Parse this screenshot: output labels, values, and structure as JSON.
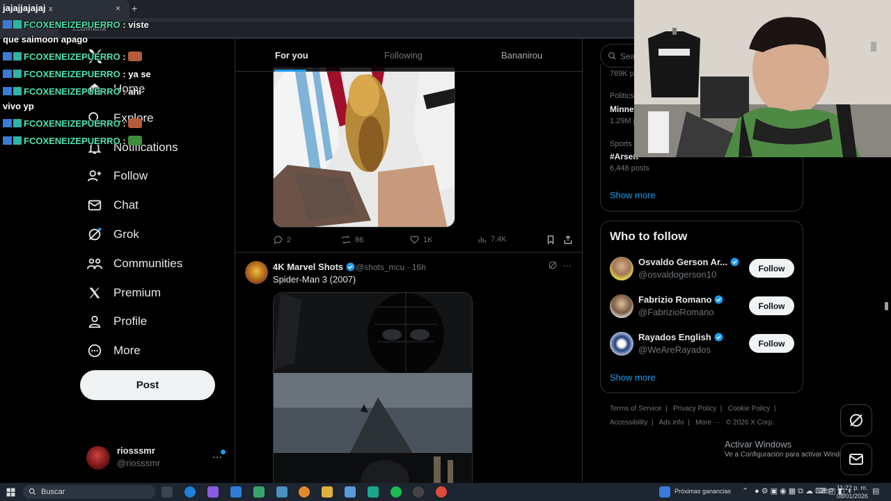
{
  "browser": {
    "tab_title": "x",
    "new_tab": "+",
    "close": "×",
    "url": "x.com/home"
  },
  "chat_overlay": {
    "title": "jajajjajajaj",
    "messages": [
      {
        "user": "FCOXENEIZEPUERRO",
        "text": ": viste"
      },
      {
        "user": "",
        "text": "que saimoon apago"
      },
      {
        "user": "FCOXENEIZEPUERRO",
        "text": ":"
      },
      {
        "user": "FCOXENEIZEPUERRO",
        "text": ": ya se"
      },
      {
        "user": "FCOXENEIZEPUERRO",
        "text": ": ahi"
      },
      {
        "user": "",
        "text": "vivo yp"
      },
      {
        "user": "FCOXENEIZEPUERRO",
        "text": ":"
      },
      {
        "user": "FCOXENEIZEPUERRO",
        "text": ":"
      }
    ]
  },
  "nav": {
    "items": [
      {
        "label": "Home",
        "icon": "home-icon"
      },
      {
        "label": "Explore",
        "icon": "search-icon"
      },
      {
        "label": "Notifications",
        "icon": "bell-icon"
      },
      {
        "label": "Follow",
        "icon": "add-user-icon"
      },
      {
        "label": "Chat",
        "icon": "mail-icon"
      },
      {
        "label": "Grok",
        "icon": "grok-icon"
      },
      {
        "label": "Communities",
        "icon": "communities-icon"
      },
      {
        "label": "Premium",
        "icon": "x-logo-icon"
      },
      {
        "label": "Profile",
        "icon": "person-icon"
      },
      {
        "label": "More",
        "icon": "more-circle-icon"
      }
    ],
    "post_label": "Post",
    "account": {
      "name": "riosssmr",
      "handle": "@riosssmr",
      "more": "···"
    }
  },
  "feed": {
    "tabs": [
      "For you",
      "Following",
      "Bananirou"
    ],
    "active_tab": "For you",
    "top_post_actions": {
      "replies": "2",
      "reposts": "86",
      "likes": "1K",
      "views": "7.4K"
    },
    "post": {
      "name": "4K Marvel Shots",
      "handle": "@shots_mcu · 16h",
      "text": "Spider-Man 3 (2007)",
      "more": "···"
    }
  },
  "right": {
    "search_placeholder": "Sea",
    "trends": [
      {
        "meta": "769K p",
        "topic": "",
        "count": ""
      },
      {
        "meta": "Politics",
        "topic": "Minne",
        "count": "1.29M p"
      },
      {
        "meta": "Sports",
        "topic": "#Arsen",
        "count": "6,448 posts"
      }
    ],
    "show_more": "Show more",
    "who_to_follow": {
      "title": "Who to follow",
      "users": [
        {
          "name": "Osvaldo Gerson Ar...",
          "handle": "@osvaldogerson10",
          "button": "Follow"
        },
        {
          "name": "Fabrizio Romano",
          "handle": "@FabrizioRomano",
          "button": "Follow"
        },
        {
          "name": "Rayados English",
          "handle": "@WeAreRayados",
          "button": "Follow"
        }
      ],
      "show_more": "Show more"
    },
    "footer": {
      "line1": [
        "Terms of Service",
        "|",
        "Privacy Policy",
        "|",
        "Cookie Policy",
        "|"
      ],
      "line2": [
        "Accessibility",
        "|",
        "Ads info",
        "|",
        "More ···",
        "© 2026 X Corp."
      ]
    }
  },
  "windows_watermark": {
    "title": "Activar Windows",
    "subtitle": "Ve a Configuración para activar Windows."
  },
  "taskbar": {
    "search": "Buscar",
    "weather": "Próximas ganancias",
    "lang": "ESP",
    "time": "11:22 p. m.",
    "date": "08/01/2026"
  },
  "colors": {
    "accent": "#1d9bf0",
    "background": "#000000",
    "border": "#2f3336",
    "chat_user": "#4fe3b1"
  }
}
